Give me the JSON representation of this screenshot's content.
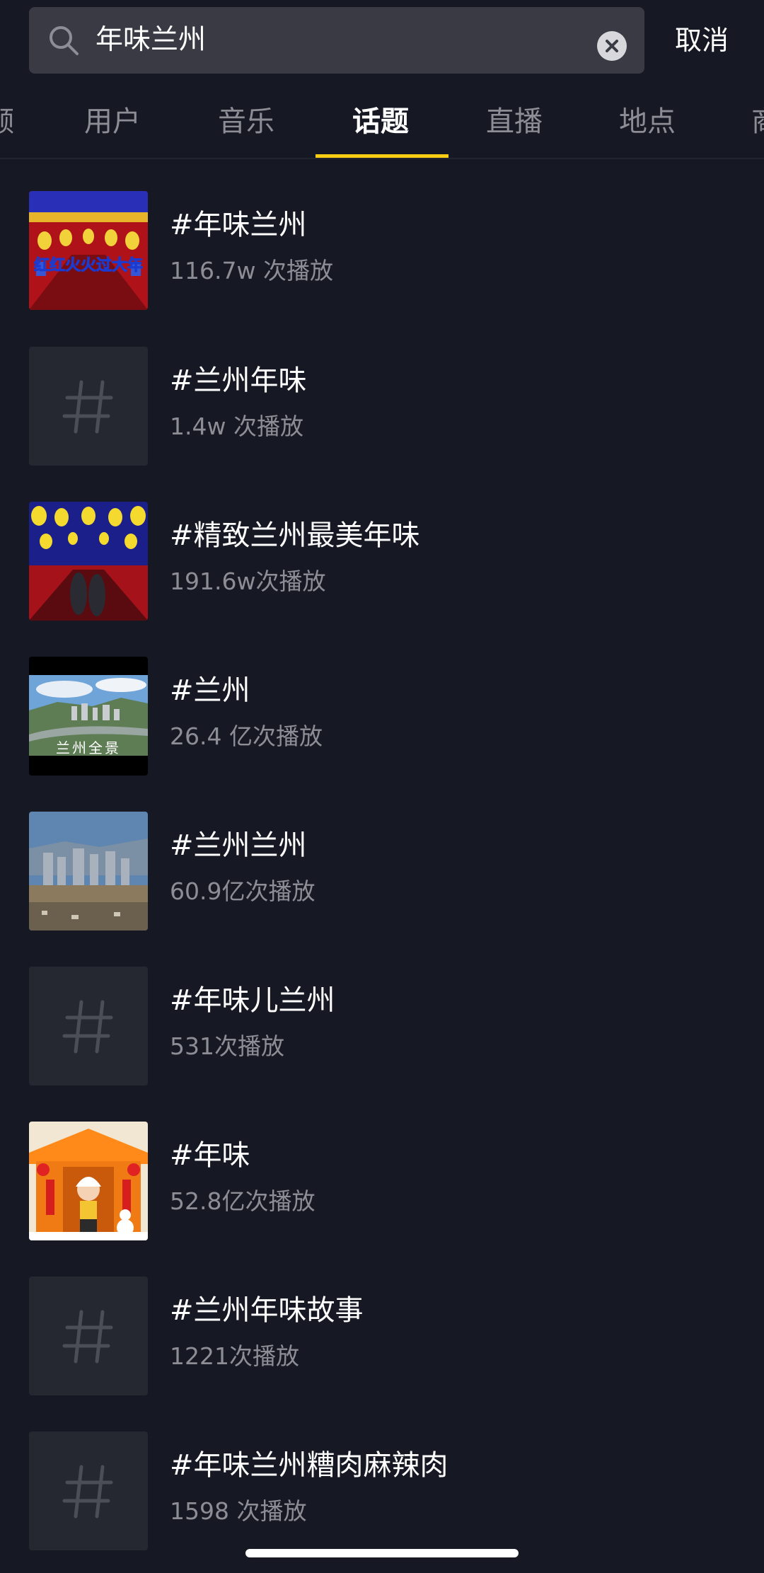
{
  "search": {
    "value": "年味兰州",
    "cancel_label": "取消"
  },
  "tabs": [
    {
      "label": "频"
    },
    {
      "label": "用户"
    },
    {
      "label": "音乐"
    },
    {
      "label": "话题",
      "active": true
    },
    {
      "label": "直播"
    },
    {
      "label": "地点"
    },
    {
      "label": "商"
    }
  ],
  "results": [
    {
      "title": "#年味兰州",
      "plays": "116.7w 次播放",
      "thumb": "lantern-street-icon",
      "caption": "红红火火过大年"
    },
    {
      "title": "#兰州年味",
      "plays": "1.4w 次播放",
      "thumb": "hashtag-icon"
    },
    {
      "title": "#精致兰州最美年味",
      "plays": "191.6w次播放",
      "thumb": "lantern-street-icon"
    },
    {
      "title": "#兰州",
      "plays": "26.4 亿次播放",
      "thumb": "city-panorama-icon",
      "caption": "兰州全景"
    },
    {
      "title": "#兰州兰州",
      "plays": "60.9亿次播放",
      "thumb": "city-river-icon"
    },
    {
      "title": "#年味儿兰州",
      "plays": "531次播放",
      "thumb": "hashtag-icon"
    },
    {
      "title": "#年味",
      "plays": "52.8亿次播放",
      "thumb": "new-year-cartoon-icon"
    },
    {
      "title": "#兰州年味故事",
      "plays": "1221次播放",
      "thumb": "hashtag-icon"
    },
    {
      "title": "#年味兰州糟肉麻辣肉",
      "plays": "1598 次播放",
      "thumb": "hashtag-icon"
    }
  ],
  "colors": {
    "background": "#161823",
    "search_bg": "#393a44",
    "accent": "#face15",
    "secondary_text": "#8d8e95",
    "placeholder_thumb": "#252731"
  }
}
